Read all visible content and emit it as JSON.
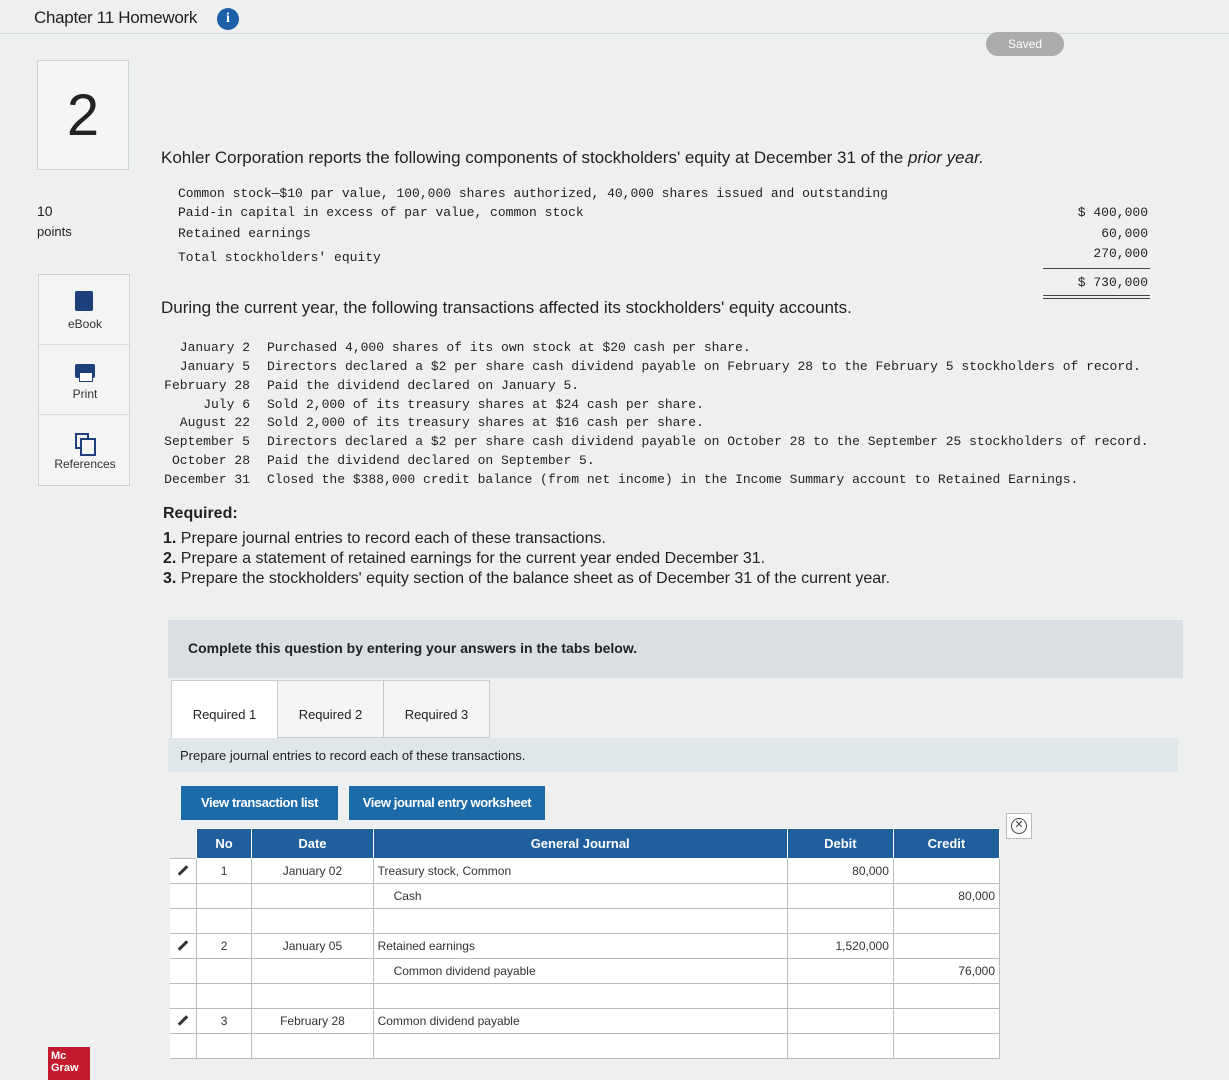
{
  "header": {
    "title": "Chapter 11 Homework",
    "saved_label": "Saved"
  },
  "question": {
    "number": "2",
    "points_value": "10",
    "points_label": "points"
  },
  "tools": [
    {
      "label": "eBook",
      "icon": "ebook-icon"
    },
    {
      "label": "Print",
      "icon": "print-icon"
    },
    {
      "label": "References",
      "icon": "references-icon"
    }
  ],
  "intro": {
    "text_a": "Kohler Corporation reports the following components of stockholders' equity at December 31 of the ",
    "text_em": "prior year."
  },
  "equity": [
    {
      "label": "Common stock—$10 par value, 100,000 shares authorized, 40,000 shares issued and outstanding",
      "amount": "$ 400,000"
    },
    {
      "label": "Paid-in capital in excess of par value, common stock",
      "amount": "60,000"
    },
    {
      "label": "Retained earnings",
      "amount": "270,000"
    },
    {
      "label": "Total stockholders' equity",
      "amount": "$ 730,000"
    }
  ],
  "during": "During the current year, the following transactions affected its stockholders' equity accounts.",
  "transactions": [
    {
      "date": "January 2",
      "desc": "Purchased 4,000 shares of its own stock at $20 cash per share."
    },
    {
      "date": "January 5",
      "desc": "Directors declared a $2 per share cash dividend payable on February 28 to the February 5 stockholders of record."
    },
    {
      "date": "February 28",
      "desc": "Paid the dividend declared on January 5."
    },
    {
      "date": "July 6",
      "desc": "Sold 2,000 of its treasury shares at $24 cash per share."
    },
    {
      "date": "August 22",
      "desc": "Sold 2,000 of its treasury shares at $16 cash per share."
    },
    {
      "date": "September 5",
      "desc": "Directors declared a $2 per share cash dividend payable on October 28 to the September 25 stockholders of record."
    },
    {
      "date": "October 28",
      "desc": "Paid the dividend declared on September 5."
    },
    {
      "date": "December 31",
      "desc": "Closed the $388,000 credit balance (from net income) in the Income Summary account to Retained Earnings."
    }
  ],
  "required": {
    "heading": "Required:",
    "items": [
      {
        "num": "1.",
        "text": " Prepare journal entries to record each of these transactions."
      },
      {
        "num": "2.",
        "text": " Prepare a statement of retained earnings for the current year ended December 31."
      },
      {
        "num": "3.",
        "text": " Prepare the stockholders' equity section of the balance sheet as of December 31 of the current year."
      }
    ]
  },
  "banner": "Complete this question by entering your answers in the tabs below.",
  "tabs": [
    "Required 1",
    "Required 2",
    "Required 3"
  ],
  "instruction": "Prepare journal entries to record each of these transactions.",
  "buttons": {
    "view_transactions": "View transaction list",
    "view_worksheet": "View journal entry worksheet"
  },
  "journal": {
    "headers": {
      "no": "No",
      "date": "Date",
      "general": "General Journal",
      "debit": "Debit",
      "credit": "Credit"
    },
    "rows": [
      {
        "no": "1",
        "date": "January 02",
        "account": "Treasury stock, Common",
        "debit": "80,000",
        "credit": "",
        "indent": false,
        "edit": true
      },
      {
        "no": "",
        "date": "",
        "account": "Cash",
        "debit": "",
        "credit": "80,000",
        "indent": true,
        "edit": false
      },
      {
        "no": "",
        "date": "",
        "account": "",
        "debit": "",
        "credit": "",
        "indent": false,
        "edit": false
      },
      {
        "no": "2",
        "date": "January 05",
        "account": "Retained earnings",
        "debit": "1,520,000",
        "credit": "",
        "indent": false,
        "edit": true
      },
      {
        "no": "",
        "date": "",
        "account": "Common dividend payable",
        "debit": "",
        "credit": "76,000",
        "indent": true,
        "edit": false
      },
      {
        "no": "",
        "date": "",
        "account": "",
        "debit": "",
        "credit": "",
        "indent": false,
        "edit": false
      },
      {
        "no": "3",
        "date": "February 28",
        "account": "Common dividend payable",
        "debit": "",
        "credit": "",
        "indent": false,
        "edit": true
      },
      {
        "no": "",
        "date": "",
        "account": "",
        "debit": "",
        "credit": "",
        "indent": false,
        "edit": false
      }
    ]
  },
  "logo": {
    "line1": "Mc",
    "line2": "Graw"
  }
}
